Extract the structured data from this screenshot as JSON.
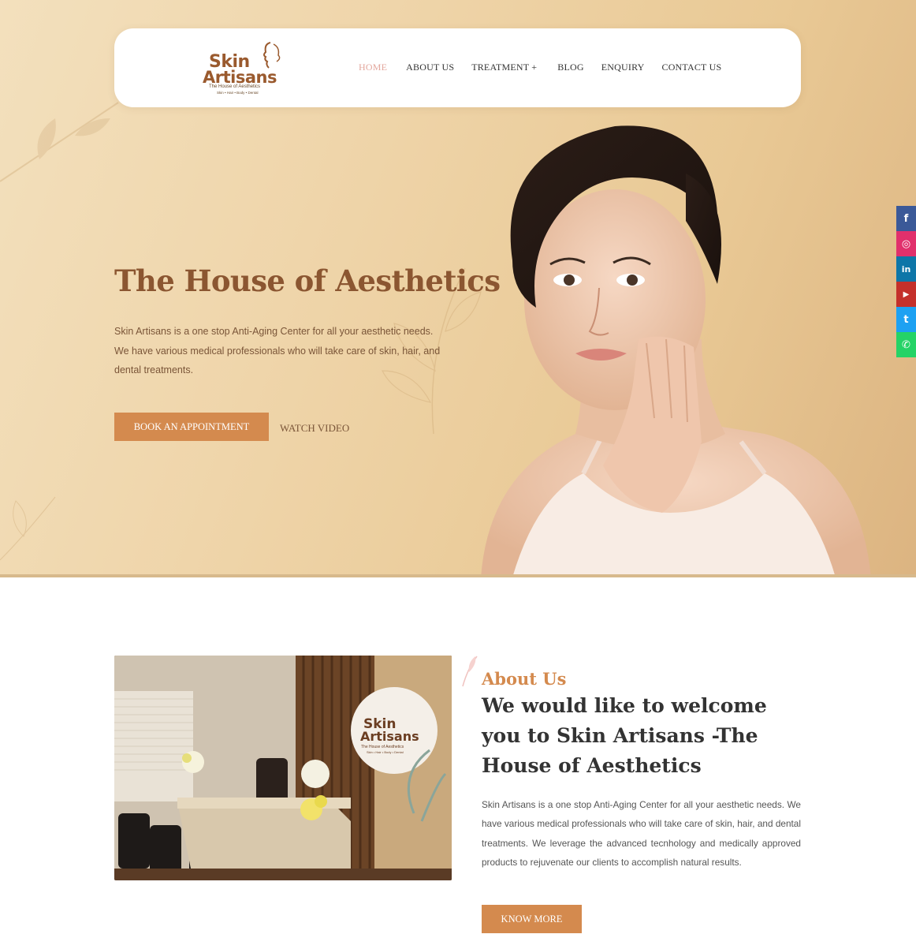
{
  "brand": {
    "name_line1": "Skin",
    "name_line2": "Artisans",
    "tagline": "The House of Aesthetics",
    "sub_tagline": "Skin • Hair • Body • Dental",
    "color": "#9a5a2e"
  },
  "nav": {
    "items": [
      {
        "label": "HOME",
        "active": true
      },
      {
        "label": "ABOUT US",
        "active": false
      },
      {
        "label": "TREATMENT +",
        "active": false
      },
      {
        "label": "BLOG",
        "active": false
      },
      {
        "label": "ENQUIRY",
        "active": false
      },
      {
        "label": "CONTACT US",
        "active": false
      }
    ]
  },
  "hero": {
    "title": "The House of Aesthetics",
    "description": "Skin Artisans is a one stop Anti-Aging Center for all your aesthetic needs. We have various medical professionals who will take care of skin, hair, and dental treatments.",
    "primary_button": "BOOK AN APPOINTMENT",
    "secondary_link": "WATCH VIDEO"
  },
  "social": [
    {
      "icon": "facebook-icon",
      "glyph": "f",
      "color": "#3b5998"
    },
    {
      "icon": "instagram-icon",
      "glyph": "◎",
      "color": "#e1306c"
    },
    {
      "icon": "linkedin-icon",
      "glyph": "in",
      "color": "#0e76a8"
    },
    {
      "icon": "youtube-icon",
      "glyph": "▶",
      "color": "#c4302b"
    },
    {
      "icon": "twitter-icon",
      "glyph": "t",
      "color": "#1da1f2"
    },
    {
      "icon": "whatsapp-icon",
      "glyph": "✆",
      "color": "#25d366"
    }
  ],
  "about": {
    "label": "About Us",
    "heading": "We would like to welcome you to Skin Artisans -The House of Aesthetics",
    "description": "Skin Artisans is a one stop Anti-Aging Center for all your aesthetic needs. We have various medical professionals who will take care of skin, hair, and dental treatments. We leverage the advanced tecnhology and medically approved products to rejuvenate our clients to accomplish natural results.",
    "button": "KNOW MORE",
    "photo_sign_line1": "Skin",
    "photo_sign_line2": "Artisans",
    "photo_sign_tagline": "The House of Aesthetics",
    "photo_sign_sub": "Skin • Hair • Body • Dental"
  },
  "colors": {
    "accent": "#d48a4e",
    "active_nav": "#e3a79d",
    "hero_title": "#8b5631"
  }
}
